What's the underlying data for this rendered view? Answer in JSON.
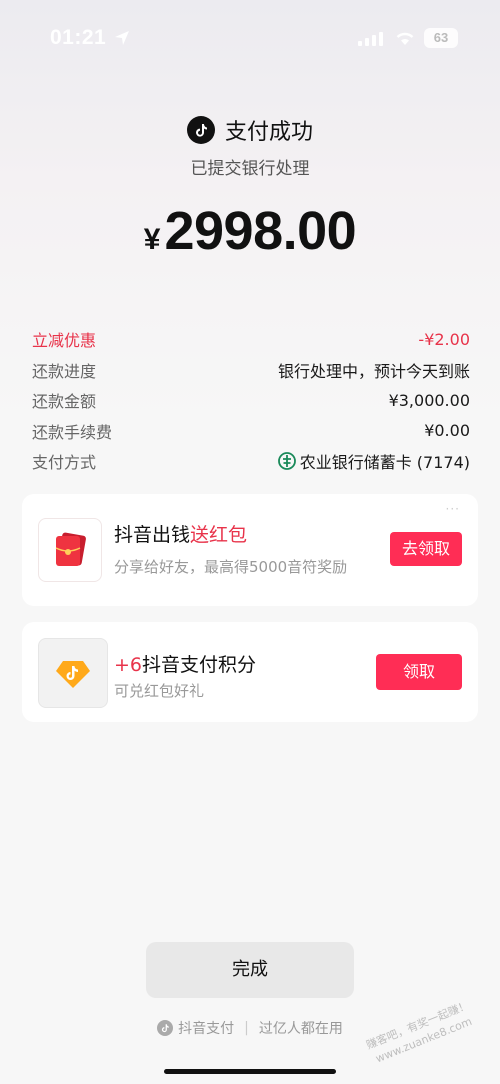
{
  "status_bar": {
    "time": "01:21",
    "battery": "63"
  },
  "header": {
    "title": "支付成功",
    "subtitle": "已提交银行处理"
  },
  "amount": {
    "currency": "¥",
    "value": "2998.00"
  },
  "details": [
    {
      "label": "立减优惠",
      "value": "-¥2.00"
    },
    {
      "label": "还款进度",
      "value": "银行处理中，预计今天到账"
    },
    {
      "label": "还款金额",
      "value": "¥3,000.00"
    },
    {
      "label": "还款手续费",
      "value": "¥0.00"
    },
    {
      "label": "支付方式",
      "value": "农业银行储蓄卡 (7174)"
    }
  ],
  "promo_card": {
    "title": "抖音出钱",
    "highlight": "送红包",
    "subtitle": "分享给好友，最高得5000音符奖励",
    "button": "去领取",
    "more": "···"
  },
  "points_card": {
    "plus": "+6",
    "title": "抖音支付积分",
    "subtitle": "可兑红包好礼",
    "button": "领取"
  },
  "done_button": "完成",
  "footer": {
    "brand": "抖音支付",
    "slogan": "过亿人都在用"
  },
  "watermark": {
    "line1": "赚客吧，有奖一起赚！",
    "line2": "www.zuanke8.com"
  },
  "colors": {
    "accent": "#ff2d55",
    "discount": "#e8334a"
  }
}
